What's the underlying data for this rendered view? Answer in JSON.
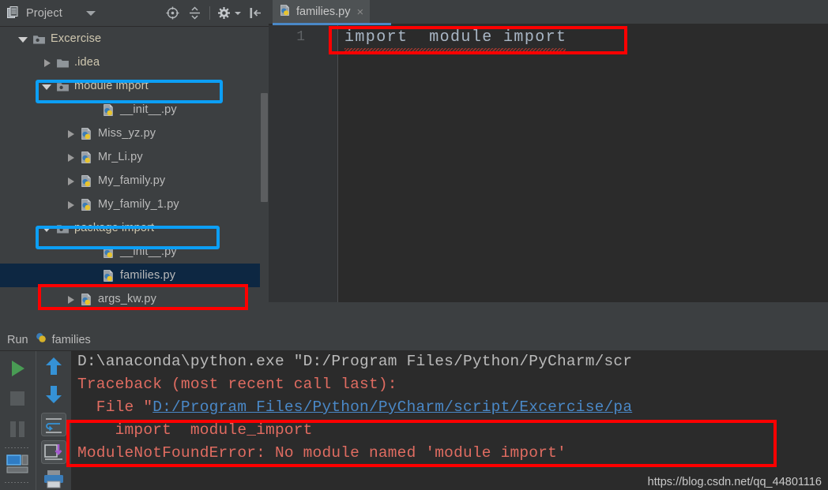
{
  "project_panel": {
    "title": "Project",
    "icons": [
      {
        "name": "project-view-icon"
      },
      {
        "name": "chevron-down-icon"
      },
      {
        "name": "locate-target-icon"
      },
      {
        "name": "collapse-all-icon"
      },
      {
        "name": "gear-icon"
      },
      {
        "name": "hide-panel-icon"
      }
    ],
    "tree": [
      {
        "label": "Excercise",
        "kind": "folder",
        "indent": 22,
        "arrow": "open",
        "icon": "module-folder-icon"
      },
      {
        "label": ".idea",
        "kind": "folder",
        "indent": 52,
        "arrow": "closed",
        "icon": "folder-icon"
      },
      {
        "label": "module import",
        "kind": "folder",
        "indent": 52,
        "arrow": "open",
        "icon": "module-folder-icon"
      },
      {
        "label": "__init__.py",
        "kind": "py",
        "indent": 110,
        "arrow": "none",
        "icon": "python-file-icon"
      },
      {
        "label": "Miss_yz.py",
        "kind": "py",
        "indent": 82,
        "arrow": "closed",
        "icon": "python-file-icon"
      },
      {
        "label": "Mr_Li.py",
        "kind": "py",
        "indent": 82,
        "arrow": "closed",
        "icon": "python-file-icon"
      },
      {
        "label": "My_family.py",
        "kind": "py",
        "indent": 82,
        "arrow": "closed",
        "icon": "python-file-icon"
      },
      {
        "label": "My_family_1.py",
        "kind": "py",
        "indent": 82,
        "arrow": "closed",
        "icon": "python-file-icon"
      },
      {
        "label": "package import",
        "kind": "folder",
        "indent": 52,
        "arrow": "open",
        "icon": "module-folder-icon"
      },
      {
        "label": "__init__.py",
        "kind": "py",
        "indent": 110,
        "arrow": "none",
        "icon": "python-file-icon"
      },
      {
        "label": "families.py",
        "kind": "py",
        "indent": 110,
        "arrow": "none",
        "icon": "python-file-icon",
        "selected": true
      },
      {
        "label": "args_kw.py",
        "kind": "py",
        "indent": 82,
        "arrow": "closed",
        "icon": "python-file-icon"
      }
    ]
  },
  "editor": {
    "tab": {
      "label": "families.py",
      "close": "×",
      "icon": "python-file-icon"
    },
    "line_number": "1",
    "code": "import  module import"
  },
  "run_panel": {
    "header_label": "Run",
    "header_config": "families",
    "header_icon": "python-file-icon",
    "left_icons": [
      {
        "name": "run-icon"
      },
      {
        "name": "stop-icon"
      },
      {
        "name": "pause-icon"
      },
      {
        "name": "layout-settings-icon"
      }
    ],
    "right_icons": [
      {
        "name": "arrow-up-icon"
      },
      {
        "name": "arrow-down-icon"
      },
      {
        "name": "soft-wrap-icon"
      },
      {
        "name": "scroll-to-end-icon"
      },
      {
        "name": "print-icon"
      }
    ],
    "console": [
      {
        "type": "normal",
        "text": "D:\\anaconda\\python.exe \"D:/Program Files/Python/PyCharm/scr"
      },
      {
        "type": "error",
        "text": "Traceback (most recent call last):"
      },
      {
        "type": "error_link",
        "prefix": "  File \"",
        "link": "D:/Program Files/Python/PyCharm/script/Excercise/pa"
      },
      {
        "type": "error",
        "text": "    import  module_import"
      },
      {
        "type": "error",
        "text": "ModuleNotFoundError: No module named 'module import'"
      }
    ]
  },
  "watermark": "https://blog.csdn.net/qq_44801116",
  "colors": {
    "accent_blue": "#0c9ff5",
    "annotation_red": "#fe0000",
    "selection_blue": "#0d2742",
    "error_red": "#e06c61",
    "link_blue": "#4a88c7",
    "run_green": "#499c54"
  }
}
